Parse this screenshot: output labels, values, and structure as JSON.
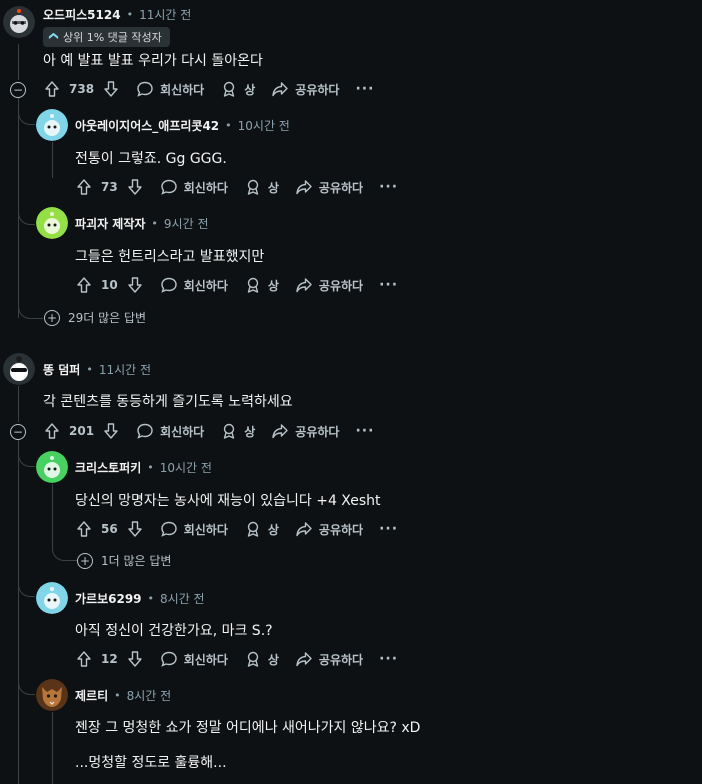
{
  "action_labels": {
    "reply": "회신하다",
    "award": "상",
    "share": "공유하다",
    "more": "···"
  },
  "comments": [
    {
      "author": "오드피스5124",
      "time": "11시간 전",
      "flair": "상위 1% 댓글 작성자",
      "body": [
        "아 예 발표 발표 우리가 다시 돌아온다"
      ],
      "votes": "738",
      "avatar_color": "#d7dadc"
    },
    {
      "author": "아웃레이지어스_애프리콧42",
      "time": "10시간 전",
      "body": [
        "전통이 그렇죠. Gg GGG."
      ],
      "votes": "73",
      "avatar_color": "#7fd6e8"
    },
    {
      "author": "파괴자 제작자",
      "time": "9시간 전",
      "body": [
        "그들은 헌트리스라고 발표했지만"
      ],
      "votes": "10",
      "avatar_color": "#94e044"
    },
    {
      "author": "똥 덤퍼",
      "time": "11시간 전",
      "body": [
        "각 콘텐츠를 동등하게 즐기도록 노력하세요"
      ],
      "votes": "201",
      "avatar_color": "#1c1c1c"
    },
    {
      "author": "크리스토퍼키",
      "time": "10시간 전",
      "body": [
        "당신의 망명자는 농사에 재능이 있습니다 +4 Xesht"
      ],
      "votes": "56",
      "avatar_color": "#46d160"
    },
    {
      "author": "가르보6299",
      "time": "8시간 전",
      "body": [
        "아직 정신이 건강한가요, 마크 S.?"
      ],
      "votes": "12",
      "avatar_color": "#7fd6e8"
    },
    {
      "author": "제르티",
      "time": "8시간 전",
      "body": [
        "젠장 그 멍청한 쇼가 정말 어디에나 새어나가지 않나요? xD",
        "...멍청할 정도로 훌륭해..."
      ],
      "avatar_color": "#8a4b24"
    }
  ],
  "more_replies": [
    "29더 많은 답변",
    "1더 많은 답변"
  ],
  "separator": "•"
}
